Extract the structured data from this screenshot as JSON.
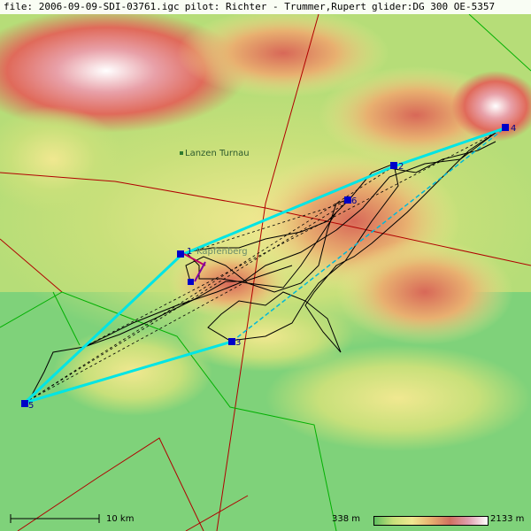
{
  "header": {
    "file": "file: 2006-09-09-SDI-03761.igc",
    "pilot": "pilot: Richter - Trummer,Rupert",
    "glider": "glider:DG 300 OE-5357"
  },
  "places": [
    {
      "name": "Lanzen Turnau"
    },
    {
      "name": "Kapfenberg"
    }
  ],
  "turnpoints": [
    {
      "label": "1"
    },
    {
      "label": "2"
    },
    {
      "label": "3"
    },
    {
      "label": "4"
    },
    {
      "label": "5"
    },
    {
      "label": "6"
    }
  ],
  "scale": {
    "label": "10 km"
  },
  "elevation": {
    "min_label": "338 m",
    "max_label": "2133 m"
  },
  "colors": {
    "task_line": "#00e5e5",
    "track": "#000000",
    "airspace": "#b00000",
    "border": "#00b000",
    "turnpoint": "#0000c8"
  }
}
